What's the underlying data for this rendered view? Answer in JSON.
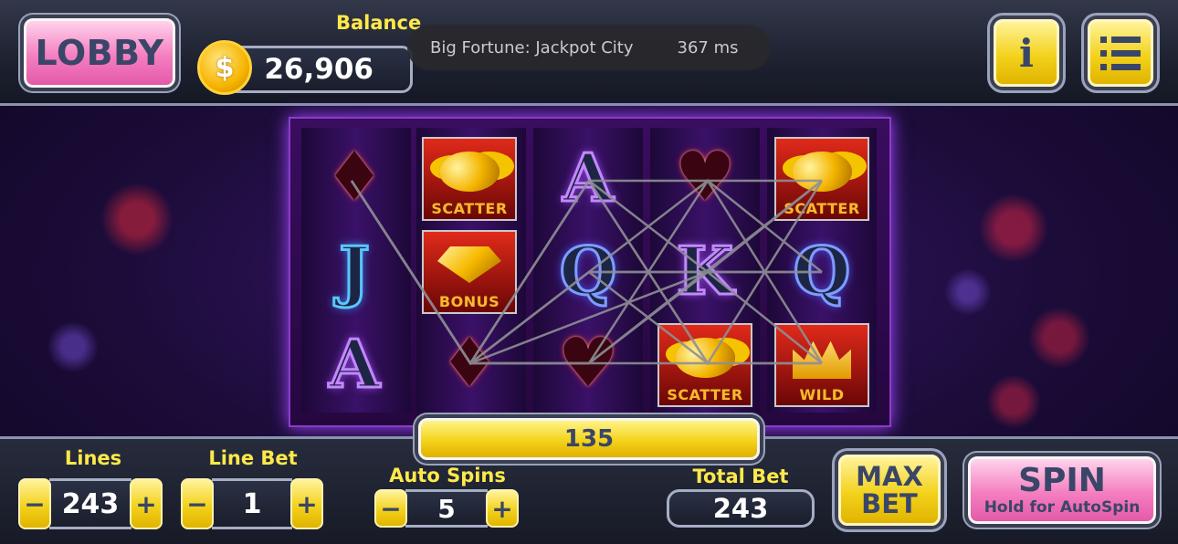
{
  "header": {
    "lobby_label": "LOBBY",
    "balance_label": "Balance",
    "balance_value": "26,906",
    "coin_symbol": "$",
    "info_label": "i",
    "menu_icon": "list-icon"
  },
  "toast": {
    "title": "Big Fortune: Jackpot City",
    "latency": "367 ms"
  },
  "reels": {
    "scatter_label": "SCATTER",
    "bonus_label": "BONUS",
    "wild_label": "WILD",
    "letters": {
      "j": "J",
      "a": "A",
      "q": "Q",
      "k": "K"
    },
    "suits": {
      "diamond": "♦",
      "heart": "♥"
    }
  },
  "win": {
    "amount": "135"
  },
  "controls": {
    "lines_label": "Lines",
    "lines_value": "243",
    "line_bet_label": "Line Bet",
    "line_bet_value": "1",
    "auto_spins_label": "Auto Spins",
    "auto_spins_value": "5",
    "total_bet_label": "Total Bet",
    "total_bet_value": "243",
    "minus": "−",
    "plus": "+",
    "max_bet_line1": "MAX",
    "max_bet_line2": "BET",
    "spin_label": "SPIN",
    "spin_sub": "Hold for AutoSpin"
  },
  "colors": {
    "accent_yellow": "#f3d21c",
    "accent_pink": "#f47ec0",
    "label_yellow": "#ffe94a",
    "panel_dark": "#1d2130"
  }
}
